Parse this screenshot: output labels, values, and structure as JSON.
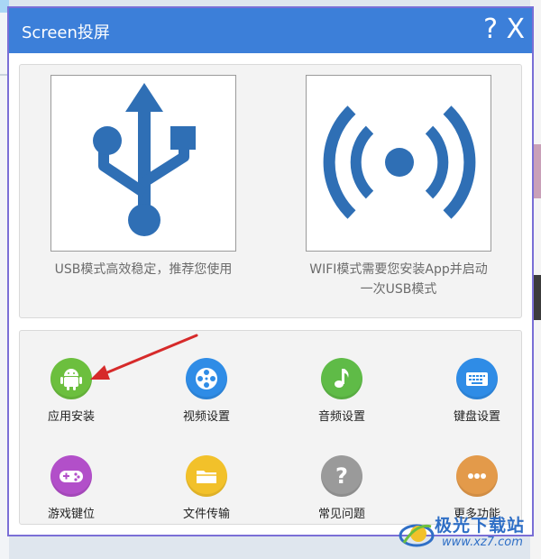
{
  "window": {
    "title": "Screen投屏",
    "help_label": "?",
    "close_label": "X"
  },
  "modes": [
    {
      "label": "USB模式高效稳定，推荐您使用",
      "icon": "usb-icon"
    },
    {
      "label_line1": "WIFI模式需要您安装App并启动",
      "label_line2": "一次USB模式",
      "icon": "wifi-icon"
    }
  ],
  "functions": [
    {
      "label": "应用安装",
      "icon": "android-icon",
      "color": "#6cbf3e"
    },
    {
      "label": "视频设置",
      "icon": "film-reel-icon",
      "color": "#2f8ce6"
    },
    {
      "label": "音频设置",
      "icon": "music-note-icon",
      "color": "#5fbb47"
    },
    {
      "label": "键盘设置",
      "icon": "keyboard-icon",
      "color": "#2f8ce6"
    },
    {
      "label": "游戏键位",
      "icon": "gamepad-icon",
      "color": "#b24fc9"
    },
    {
      "label": "文件传输",
      "icon": "folder-icon",
      "color": "#f2c12a"
    },
    {
      "label": "常见问题",
      "icon": "question-icon",
      "color": "#9a9a9a"
    },
    {
      "label": "更多功能",
      "icon": "more-icon",
      "color": "#e39a4a"
    }
  ],
  "watermark": {
    "text": "极光下载站",
    "url": "www.xz7.com"
  },
  "colors": {
    "titlebar": "#3c7fd9",
    "icon_blue": "#2f6fb5",
    "annotation_arrow": "#d62a2a"
  }
}
